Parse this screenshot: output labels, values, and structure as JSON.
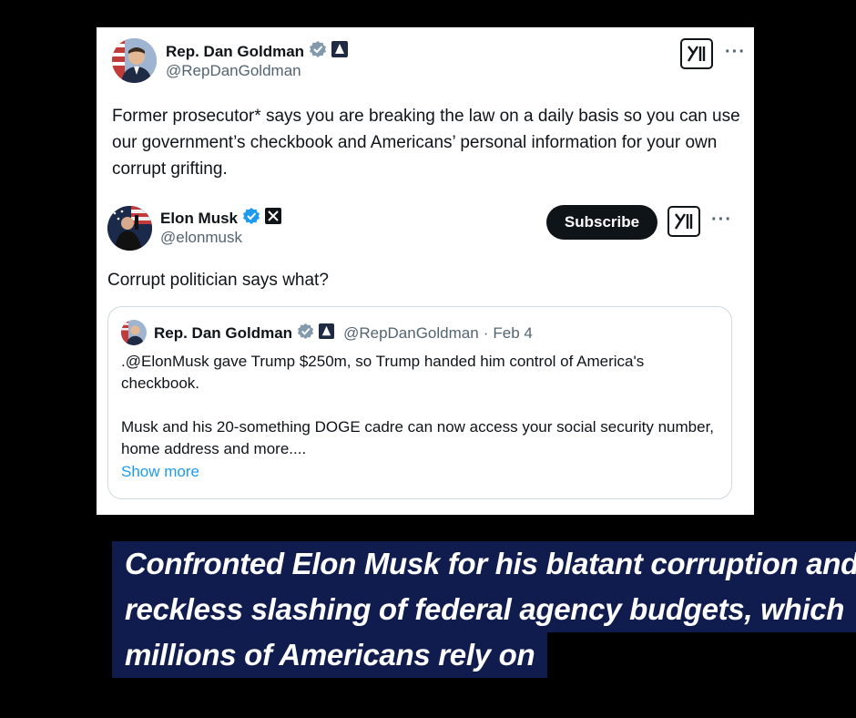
{
  "tweet": {
    "author_name": "Rep. Dan Goldman",
    "author_handle": "@RepDanGoldman",
    "text": "Former prosecutor* says you are breaking the law on a daily basis so you can use our government’s checkbook and Americans’ personal information for your own corrupt grifting.",
    "logo_icon": "x-grok-icon",
    "more_icon": "···"
  },
  "reply": {
    "author_name": "Elon Musk",
    "author_handle": "@elonmusk",
    "subscribe_label": "Subscribe",
    "text": "Corrupt politician says what?",
    "more_icon": "···"
  },
  "quoted": {
    "author_name": "Rep. Dan Goldman",
    "author_handle": "@RepDanGoldman",
    "date": "Feb 4",
    "separator": "·",
    "paragraph1": ".@ElonMusk gave Trump $250m, so Trump handed him control of America's checkbook.",
    "paragraph2": "Musk and his 20-something DOGE cadre can now access your social security number, home address and more....",
    "show_more": "Show more"
  },
  "caption": {
    "line1": "Confronted Elon Musk for his blatant corruption and",
    "line2": "reckless slashing of federal agency budgets, which",
    "line3": "millions of Americans rely on"
  },
  "colors": {
    "verified_grey": "#829aab",
    "verified_blue": "#1d9bf0",
    "link_blue": "#1d9bf0",
    "caption_bg": "#0f1c4d"
  }
}
